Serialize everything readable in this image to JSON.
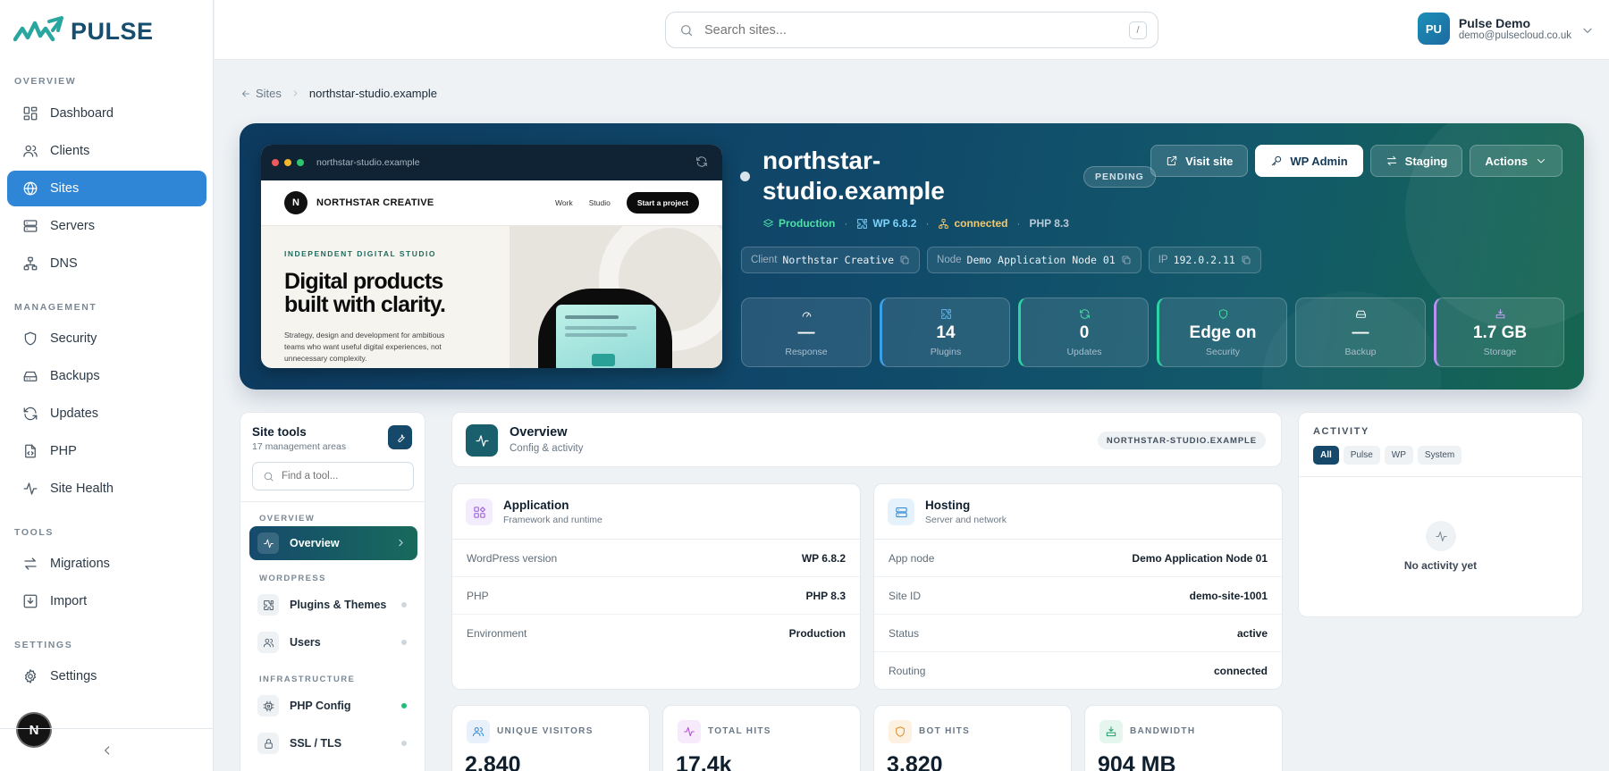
{
  "brand": {
    "name": "PULSE"
  },
  "sidebar": {
    "sections": [
      {
        "label": "OVERVIEW"
      },
      {
        "label": "MANAGEMENT"
      },
      {
        "label": "TOOLS"
      },
      {
        "label": "SETTINGS"
      }
    ],
    "items": [
      {
        "label": "Dashboard",
        "icon": "grid-icon"
      },
      {
        "label": "Clients",
        "icon": "users-icon"
      },
      {
        "label": "Sites",
        "icon": "globe-icon",
        "active": true
      },
      {
        "label": "Servers",
        "icon": "server-icon"
      },
      {
        "label": "DNS",
        "icon": "network-icon"
      },
      {
        "label": "Security",
        "icon": "shield-icon"
      },
      {
        "label": "Backups",
        "icon": "hard-drive-icon"
      },
      {
        "label": "Updates",
        "icon": "refresh-icon"
      },
      {
        "label": "PHP",
        "icon": "file-code-icon"
      },
      {
        "label": "Site Health",
        "icon": "activity-icon"
      },
      {
        "label": "Migrations",
        "icon": "arrows-icon"
      },
      {
        "label": "Import",
        "icon": "import-icon"
      },
      {
        "label": "Settings",
        "icon": "gear-icon"
      }
    ],
    "avatar_letter": "N"
  },
  "topbar": {
    "search_placeholder": "Search sites...",
    "shortcut": "/",
    "user": {
      "initials": "PU",
      "name": "Pulse Demo",
      "email": "demo@pulsecloud.co.uk"
    }
  },
  "breadcrumb": {
    "back": "Sites",
    "current": "northstar-studio.example"
  },
  "hero": {
    "preview": {
      "url": "northstar-studio.example",
      "logo_letter": "N",
      "brand": "NORTHSTAR CREATIVE",
      "links": [
        "Work",
        "Studio"
      ],
      "cta": "Start a project",
      "kicker": "INDEPENDENT DIGITAL STUDIO",
      "headline": "Digital products built with clarity.",
      "body": "Strategy, design and development for ambitious teams who want useful digital experiences, not unnecessary complexity."
    },
    "title": "northstar-studio.example",
    "status": "PENDING",
    "meta": {
      "environment": "Production",
      "wp": "WP 6.8.2",
      "connection": "connected",
      "php": "PHP 8.3"
    },
    "chips": [
      {
        "label": "Client",
        "value": "Northstar Creative"
      },
      {
        "label": "Node",
        "value": "Demo Application Node 01"
      },
      {
        "label": "IP",
        "value": "192.0.2.11"
      }
    ],
    "buttons": {
      "visit": "Visit site",
      "wp_admin": "WP Admin",
      "staging": "Staging",
      "actions": "Actions"
    },
    "stats": [
      {
        "value": "—",
        "label": "Response",
        "icon": "gauge-icon"
      },
      {
        "value": "14",
        "label": "Plugins",
        "icon": "puzzle-icon"
      },
      {
        "value": "0",
        "label": "Updates",
        "icon": "refresh-icon"
      },
      {
        "value": "Edge on",
        "label": "Security",
        "icon": "shield-icon"
      },
      {
        "value": "—",
        "label": "Backup",
        "icon": "hard-drive-icon"
      },
      {
        "value": "1.7 GB",
        "label": "Storage",
        "icon": "storage-icon"
      }
    ],
    "colors": {
      "production": "#4fe0a8",
      "wp": "#7dd3fc",
      "connected": "#f5c96a",
      "php": "#b9cbd8"
    }
  },
  "tools": {
    "title": "Site tools",
    "subtitle": "17 management areas",
    "search_placeholder": "Find a tool...",
    "sections": [
      "OVERVIEW",
      "WORDPRESS",
      "INFRASTRUCTURE"
    ],
    "items": [
      {
        "label": "Overview",
        "icon": "activity-icon"
      },
      {
        "label": "Plugins & Themes",
        "icon": "puzzle-icon"
      },
      {
        "label": "Users",
        "icon": "users-icon"
      },
      {
        "label": "PHP Config",
        "icon": "cpu-icon"
      },
      {
        "label": "SSL / TLS",
        "icon": "lock-icon"
      }
    ]
  },
  "overview": {
    "title": "Overview",
    "subtitle": "Config & activity",
    "tag": "NORTHSTAR-STUDIO.EXAMPLE"
  },
  "application": {
    "title": "Application",
    "subtitle": "Framework and runtime",
    "rows": [
      {
        "k": "WordPress version",
        "v": "WP 6.8.2"
      },
      {
        "k": "PHP",
        "v": "PHP 8.3"
      },
      {
        "k": "Environment",
        "v": "Production"
      }
    ]
  },
  "hosting": {
    "title": "Hosting",
    "subtitle": "Server and network",
    "rows": [
      {
        "k": "App node",
        "v": "Demo Application Node 01"
      },
      {
        "k": "Site ID",
        "v": "demo-site-1001"
      },
      {
        "k": "Status",
        "v": "active"
      },
      {
        "k": "Routing",
        "v": "connected"
      }
    ]
  },
  "metrics": [
    {
      "label": "UNIQUE VISITORS",
      "value": "2,840"
    },
    {
      "label": "TOTAL HITS",
      "value": "17.4k"
    },
    {
      "label": "BOT HITS",
      "value": "3,820"
    },
    {
      "label": "BANDWIDTH",
      "value": "904 MB"
    }
  ],
  "activity": {
    "title": "ACTIVITY",
    "tabs": [
      "All",
      "Pulse",
      "WP",
      "System"
    ],
    "empty": "No activity yet"
  }
}
